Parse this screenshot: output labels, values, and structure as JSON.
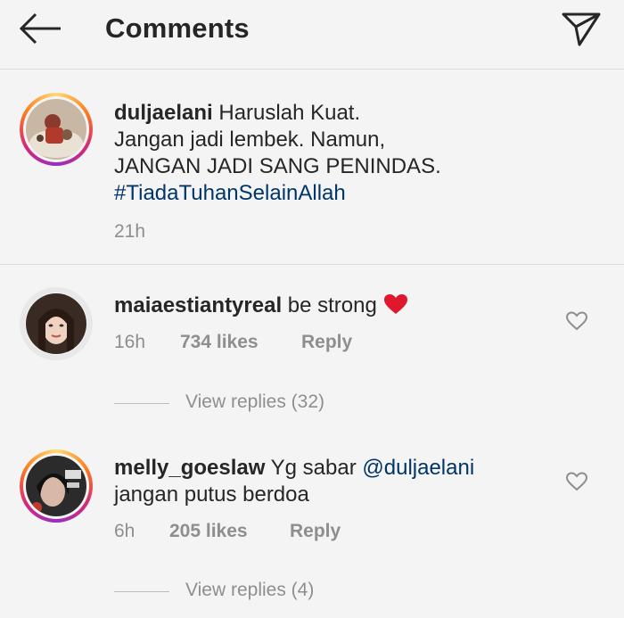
{
  "header": {
    "title": "Comments"
  },
  "caption": {
    "username": "duljaelani",
    "text_first": " Haruslah Kuat.",
    "line2": "Jangan jadi lembek. Namun,",
    "line3": "JANGAN JADI SANG PENINDAS.",
    "hashtag": "#TiadaTuhanSelainAllah",
    "time": "21h"
  },
  "comments": [
    {
      "username": "maiaestiantyreal",
      "text": " be strong ",
      "emoji": "heart-emoji",
      "time": "16h",
      "likes": "734 likes",
      "reply": "Reply",
      "view_replies": "View replies (32)"
    },
    {
      "username": "melly_goeslaw",
      "text": " Yg sabar ",
      "mention": "@duljaelani",
      "line2": "jangan putus berdoa",
      "time": "6h",
      "likes": "205 likes",
      "reply": "Reply",
      "view_replies": "View replies (4)"
    }
  ],
  "icons": {
    "back": "arrow-left-icon",
    "share": "paper-plane-icon",
    "like": "heart-outline-icon"
  },
  "colors": {
    "link": "#003569",
    "muted": "#8e8e8e",
    "heart": "#e0182d"
  }
}
